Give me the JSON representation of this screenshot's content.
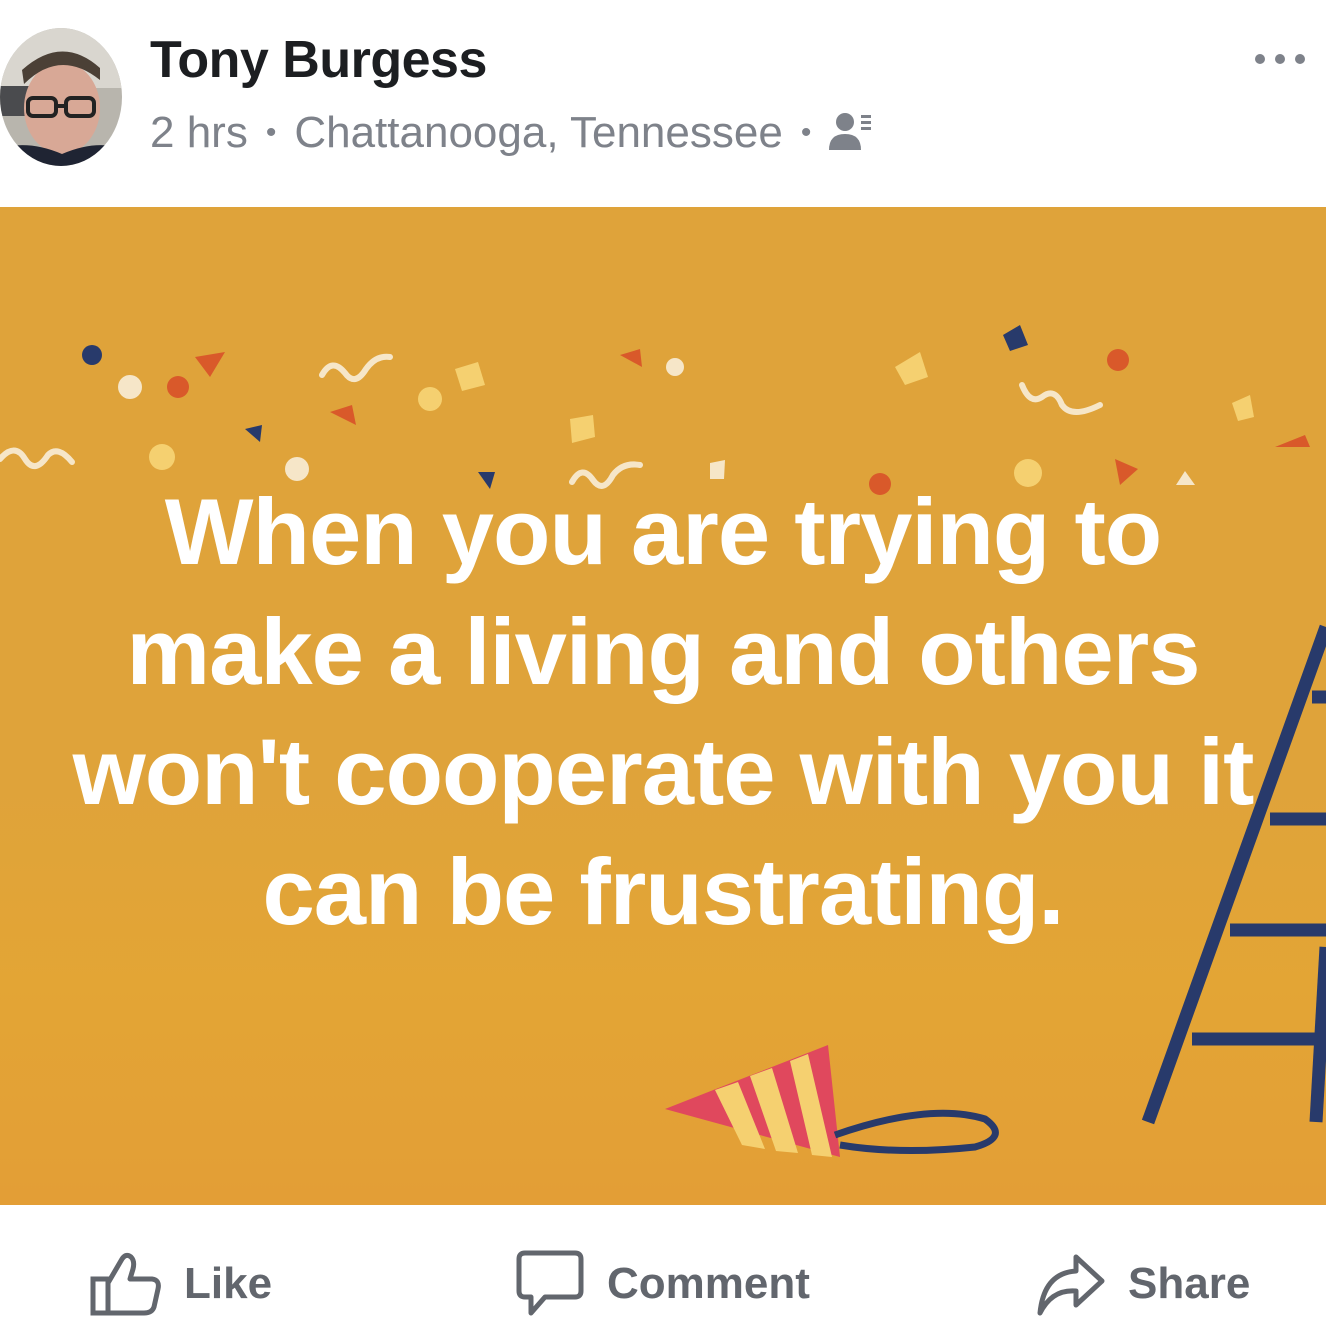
{
  "post": {
    "author": "Tony Burgess",
    "time": "2 hrs",
    "location": "Chattanooga, Tennessee",
    "separator": "•",
    "audience_icon": "custom-audience-icon",
    "more_icon": "more-options-icon",
    "text_lines": [
      "When you are trying to",
      "make a living and others",
      "won't cooperate with you it",
      "can be frustrating."
    ],
    "background_color": "#dfa33a"
  },
  "actions": {
    "like": "Like",
    "comment": "Comment",
    "share": "Share"
  },
  "colors": {
    "text_meta": "#7e828a",
    "action_text": "#62666d",
    "ladder": "#283a6b",
    "hat": "#e0485d"
  }
}
